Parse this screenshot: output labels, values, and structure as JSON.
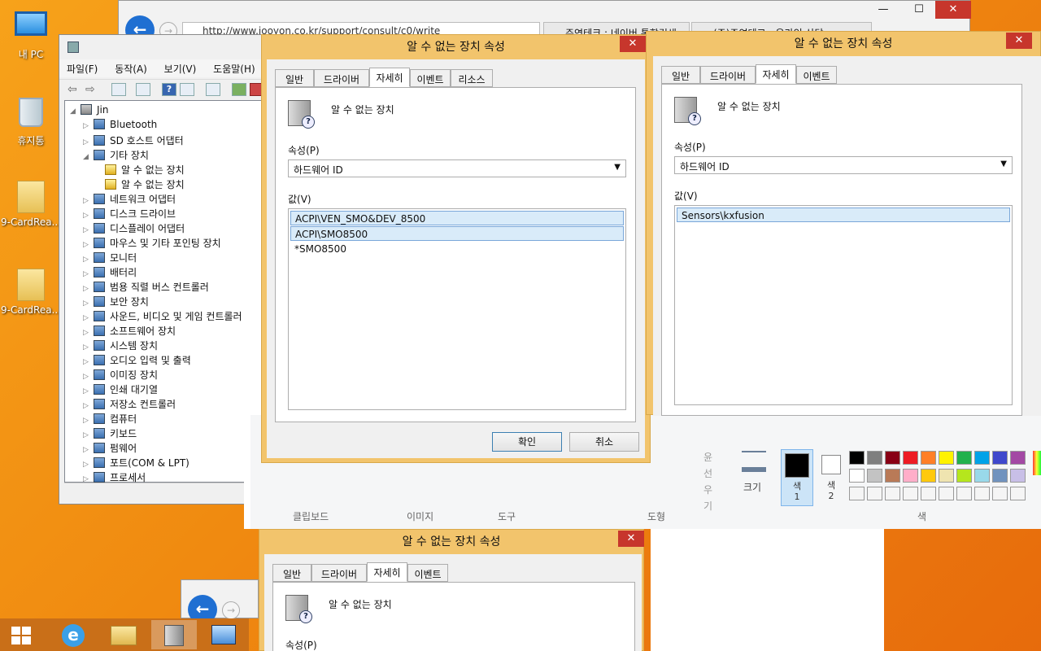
{
  "desktop": {
    "icons": [
      {
        "label": "내 PC"
      },
      {
        "label": "휴지통"
      },
      {
        "label": "9-CardRea..."
      },
      {
        "label": "9-CardRea..."
      }
    ]
  },
  "browser": {
    "url": "http://www.jooyon.co.kr/support/consult/c0/write",
    "tabs": [
      {
        "label": "주연테크 : 네이버 통합검색"
      },
      {
        "label": "(주)주연테크 - 온라인 상담"
      }
    ]
  },
  "devmgr": {
    "menu": [
      "파일(F)",
      "동작(A)",
      "보기(V)",
      "도움말(H)"
    ],
    "root": "Jin",
    "items": [
      {
        "label": "Bluetooth",
        "expanded": false
      },
      {
        "label": "SD 호스트 어댑터",
        "expanded": false
      },
      {
        "label": "기타 장치",
        "expanded": true
      },
      {
        "label": "알 수 없는 장치",
        "child": true
      },
      {
        "label": "알 수 없는 장치",
        "child": true
      },
      {
        "label": "네트워크 어댑터",
        "expanded": false
      },
      {
        "label": "디스크 드라이브",
        "expanded": false
      },
      {
        "label": "디스플레이 어댑터",
        "expanded": false
      },
      {
        "label": "마우스 및 기타 포인팅 장치",
        "expanded": false
      },
      {
        "label": "모니터",
        "expanded": false
      },
      {
        "label": "배터리",
        "expanded": false
      },
      {
        "label": "범용 직렬 버스 컨트롤러",
        "expanded": false
      },
      {
        "label": "보안 장치",
        "expanded": false
      },
      {
        "label": "사운드, 비디오 및 게임 컨트롤러",
        "expanded": false
      },
      {
        "label": "소프트웨어 장치",
        "expanded": false
      },
      {
        "label": "시스템 장치",
        "expanded": false
      },
      {
        "label": "오디오 입력 및 출력",
        "expanded": false
      },
      {
        "label": "이미징 장치",
        "expanded": false
      },
      {
        "label": "인쇄 대기열",
        "expanded": false
      },
      {
        "label": "저장소 컨트롤러",
        "expanded": false
      },
      {
        "label": "컴퓨터",
        "expanded": false
      },
      {
        "label": "키보드",
        "expanded": false
      },
      {
        "label": "펌웨어",
        "expanded": false
      },
      {
        "label": "포트(COM & LPT)",
        "expanded": false
      },
      {
        "label": "프로세서",
        "expanded": false
      }
    ]
  },
  "paint": {
    "size_label": "크기",
    "color1_label": "색\n1",
    "color2_label": "색\n2",
    "group_labels": [
      "클립보드",
      "이미지",
      "도구",
      "도형",
      "색"
    ],
    "side_labels": [
      "윤선",
      "우기"
    ],
    "palette_row1": [
      "#000000",
      "#7f7f7f",
      "#880015",
      "#ed1c24",
      "#ff7f27",
      "#fff200",
      "#22b14c",
      "#00a2e8",
      "#3f48cc",
      "#a349a4"
    ],
    "palette_row2": [
      "#ffffff",
      "#c3c3c3",
      "#b97a57",
      "#ffaec9",
      "#ffc90e",
      "#efe4b0",
      "#b5e61d",
      "#99d9ea",
      "#7092be",
      "#c8bfe7"
    ]
  },
  "dialog1": {
    "title": "알 수 없는 장치 속성",
    "tabs": [
      "일반",
      "드라이버",
      "자세히",
      "이벤트",
      "리소스"
    ],
    "active_tab": "자세히",
    "device_name": "알 수 없는 장치",
    "property_label": "속성(P)",
    "property_value": "하드웨어 ID",
    "value_label": "값(V)",
    "values": [
      "ACPI\\VEN_SMO&DEV_8500",
      "ACPI\\SMO8500",
      "*SMO8500"
    ],
    "ok": "확인",
    "cancel": "취소"
  },
  "dialog2": {
    "title": "알 수 없는 장치 속성",
    "tabs": [
      "일반",
      "드라이버",
      "자세히",
      "이벤트"
    ],
    "active_tab": "자세히",
    "device_name": "알 수 없는 장치",
    "property_label": "속성(P)",
    "property_value": "하드웨어 ID",
    "value_label": "값(V)",
    "values": [
      "Sensors\\kxfusion"
    ]
  },
  "dialog3": {
    "title": "알 수 없는 장치 속성",
    "tabs": [
      "일반",
      "드라이버",
      "자세히",
      "이벤트"
    ],
    "active_tab": "자세히",
    "device_name": "알 수 없는 장치",
    "property_label": "속성(P)"
  },
  "colors": {
    "dialog_frame": "#f2c46c",
    "close": "#c7362c",
    "selection": "#d9ebf9"
  }
}
